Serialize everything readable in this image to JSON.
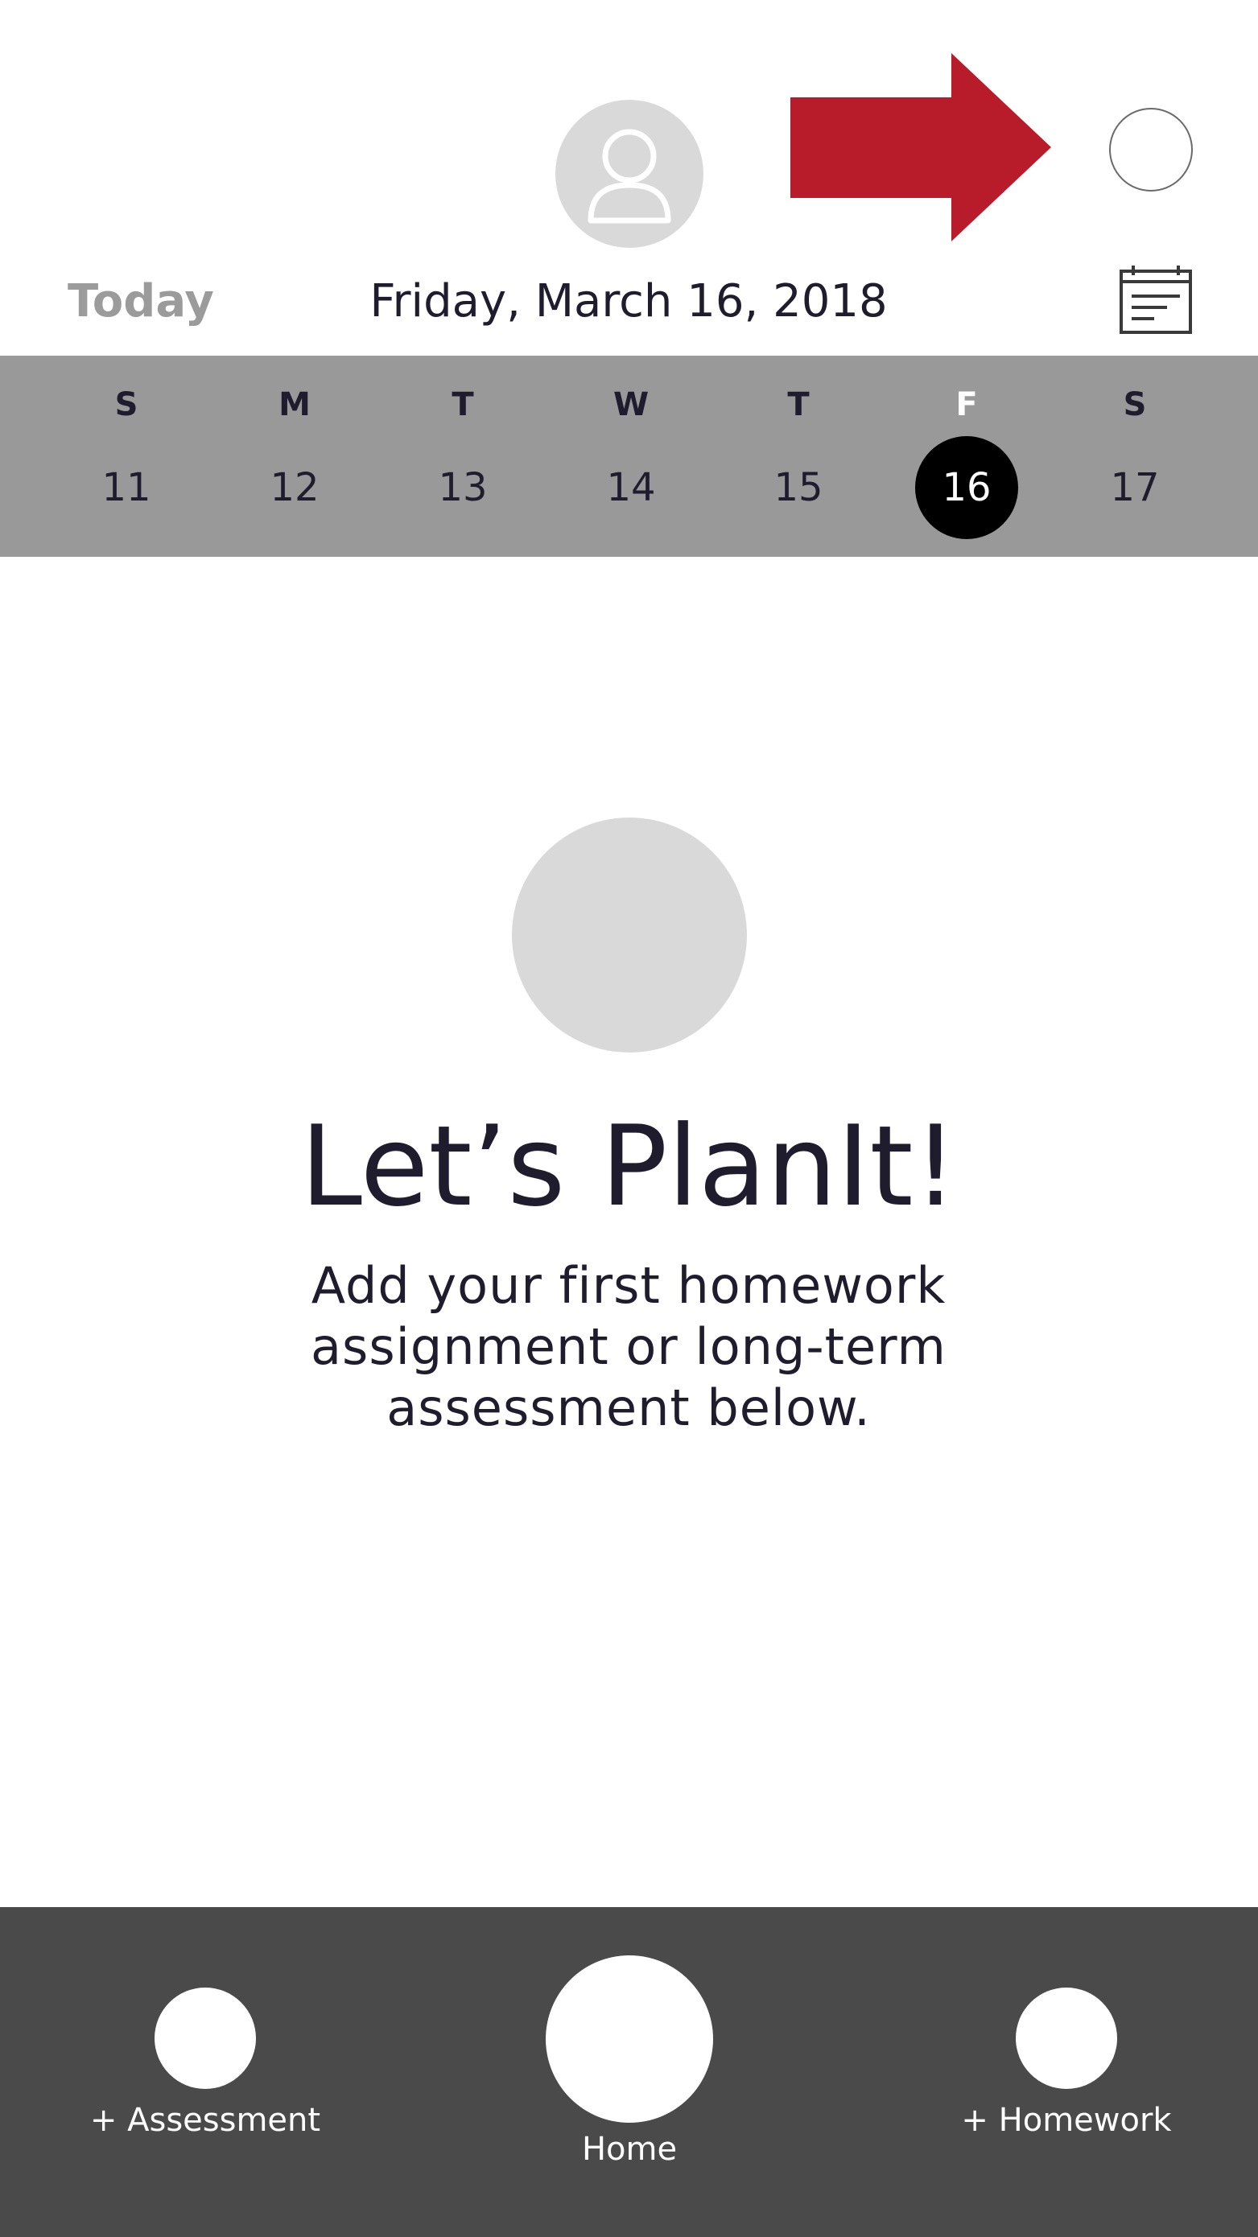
{
  "header": {
    "today_label": "Today",
    "date_title": "Friday, March 16, 2018",
    "avatar_icon": "user-icon",
    "calendar_icon": "calendar-icon",
    "arrow_color": "#b81c2b"
  },
  "week": {
    "days": [
      {
        "letter": "S",
        "number": "11",
        "selected": false
      },
      {
        "letter": "M",
        "number": "12",
        "selected": false
      },
      {
        "letter": "T",
        "number": "13",
        "selected": false
      },
      {
        "letter": "W",
        "number": "14",
        "selected": false
      },
      {
        "letter": "T",
        "number": "15",
        "selected": false
      },
      {
        "letter": "F",
        "number": "16",
        "selected": true
      },
      {
        "letter": "S",
        "number": "17",
        "selected": false
      }
    ]
  },
  "empty_state": {
    "title": "Let’s PlanIt!",
    "description": "Add your first homework assignment or long-term assessment below."
  },
  "bottom_nav": {
    "assessment_label": "+ Assessment",
    "home_label": "Home",
    "homework_label": "+ Homework"
  },
  "colors": {
    "week_strip_bg": "#999999",
    "bottom_bar_bg": "#4a4a4a",
    "selected_day_bg": "#000000",
    "placeholder_gray": "#d9d9d9"
  }
}
